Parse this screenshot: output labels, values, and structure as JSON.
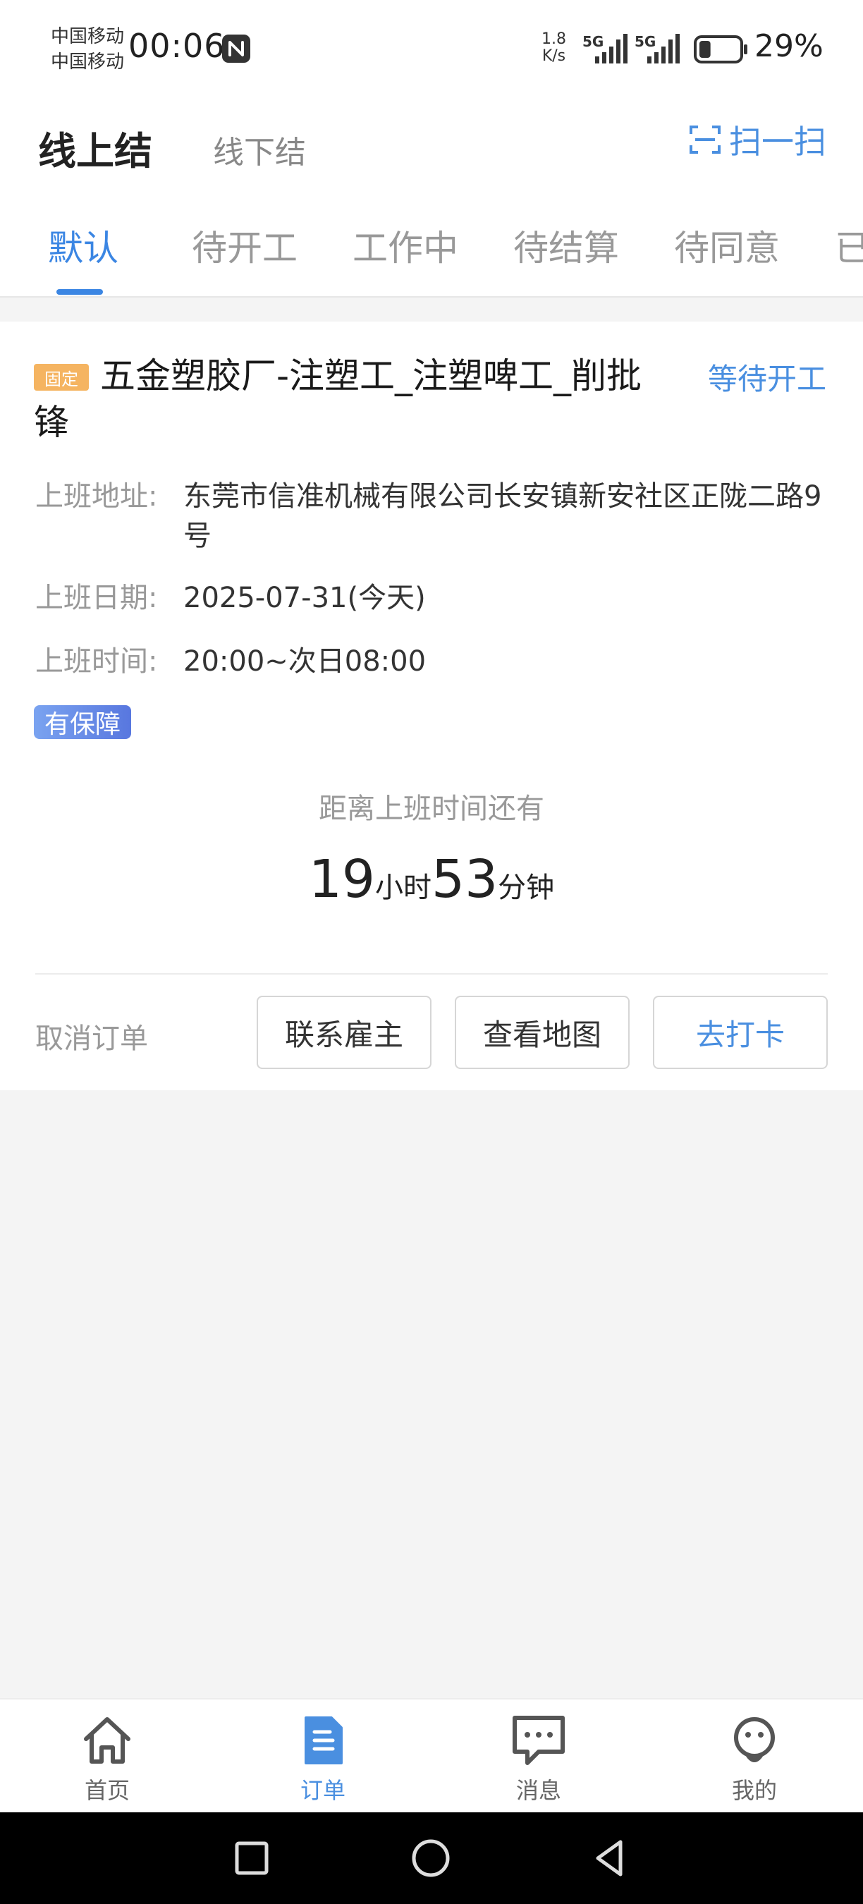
{
  "status_bar": {
    "carrier_1": "中国移动",
    "carrier_2": "中国移动",
    "time": "00:06",
    "net_speed_value": "1.8",
    "net_speed_unit": "K/s",
    "signal_1": "5G",
    "signal_2": "5G",
    "battery_percent_text": "29%",
    "battery_level": 0.29
  },
  "header": {
    "tab_online": "线上结",
    "tab_offline": "线下结",
    "scan_label": "扫一扫"
  },
  "tabs": [
    {
      "label": "默认",
      "active": true
    },
    {
      "label": "待开工",
      "active": false
    },
    {
      "label": "工作中",
      "active": false
    },
    {
      "label": "待结算",
      "active": false
    },
    {
      "label": "待同意",
      "active": false
    },
    {
      "label": "已",
      "active": false
    }
  ],
  "order": {
    "badge": "固定",
    "title": "五金塑胶厂-注塑工_注塑啤工_削批锋",
    "status": "等待开工",
    "address_label": "上班地址:",
    "address_value": "东莞市信准机械有限公司长安镇新安社区正陇二路9号",
    "date_label": "上班日期:",
    "date_value": "2025-07-31(今天)",
    "time_label": "上班时间:",
    "time_value": "20:00~次日08:00",
    "guarantee_badge": "有保障",
    "countdown_label": "距离上班时间还有",
    "countdown_hours": "19",
    "countdown_hours_unit": "小时",
    "countdown_minutes": "53",
    "countdown_minutes_unit": "分钟",
    "cancel_label": "取消订单",
    "btn_contact": "联系雇主",
    "btn_map": "查看地图",
    "btn_clock_in": "去打卡"
  },
  "bottom_nav": [
    {
      "label": "首页",
      "icon": "home-icon",
      "active": false
    },
    {
      "label": "订单",
      "icon": "order-icon",
      "active": true
    },
    {
      "label": "消息",
      "icon": "message-icon",
      "active": false
    },
    {
      "label": "我的",
      "icon": "profile-icon",
      "active": false
    }
  ],
  "colors": {
    "accent": "#3b86e3",
    "badge_fixed": "#f5b461",
    "guarantee_start": "#7aa3f0",
    "guarantee_end": "#5877df"
  }
}
